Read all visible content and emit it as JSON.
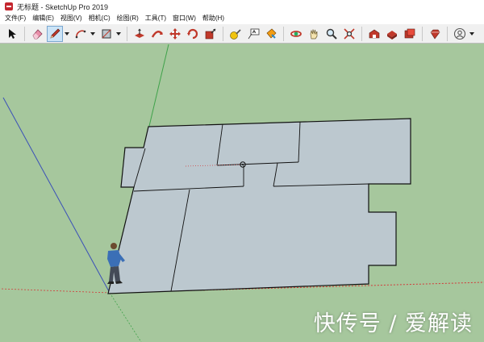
{
  "window": {
    "title": "无标题 - SketchUp Pro 2019"
  },
  "menu": {
    "items": [
      {
        "label": "文件(F)"
      },
      {
        "label": "编辑(E)"
      },
      {
        "label": "视图(V)"
      },
      {
        "label": "相机(C)"
      },
      {
        "label": "绘图(R)"
      },
      {
        "label": "工具(T)"
      },
      {
        "label": "窗口(W)"
      },
      {
        "label": "帮助(H)"
      }
    ]
  },
  "toolbar": {
    "tools": [
      "select-icon",
      "eraser-icon",
      "pencil-line-icon",
      "arc-icon",
      "rectangle-icon",
      "push-pull-icon",
      "follow-me-icon",
      "move-icon",
      "rotate-icon",
      "scale-icon",
      "tape-measure-icon",
      "text-icon",
      "paint-bucket-icon",
      "orbit-icon",
      "pan-icon",
      "zoom-icon",
      "zoom-extents-icon",
      "warehouse-icon",
      "extension-warehouse-icon",
      "layout-icon",
      "ruby-icon",
      "account-icon"
    ],
    "active_tool": "pencil-line-icon"
  },
  "colors": {
    "ground": "#a6c79d",
    "face": "#bcc8cf",
    "edge": "#111111",
    "axis_red": "#d23a3a",
    "axis_green": "#3fa24a",
    "axis_blue": "#3a4fb8"
  },
  "watermark": {
    "text": "快传号 / 爱解读"
  }
}
